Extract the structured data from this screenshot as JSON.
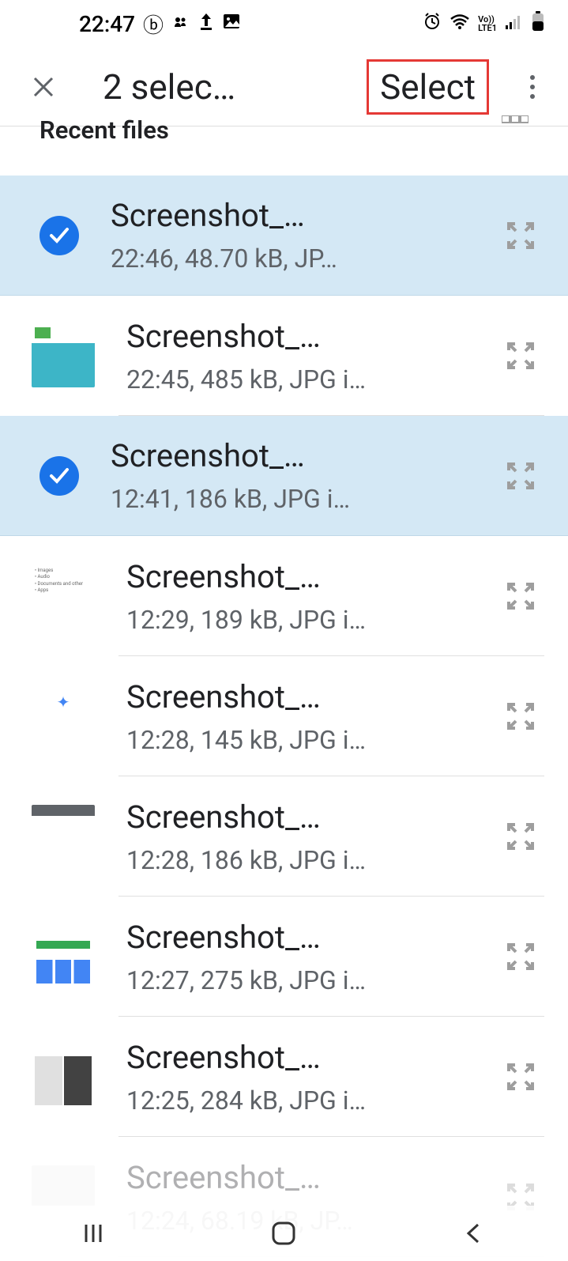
{
  "status": {
    "time": "22:47",
    "network_label": "LTE1",
    "volte": "Vo))"
  },
  "header": {
    "title": "2 selec…",
    "select_label": "Select"
  },
  "section": {
    "title": "Recent files"
  },
  "files": [
    {
      "name": "Screenshot_…",
      "meta": "22:46, 48.70 kB, JP…",
      "selected": true,
      "thumb": "none"
    },
    {
      "name": "Screenshot_…",
      "meta": "22:45, 485 kB, JPG i…",
      "selected": false,
      "thumb": "pool"
    },
    {
      "name": "Screenshot_…",
      "meta": "12:41, 186 kB, JPG i…",
      "selected": true,
      "thumb": "none"
    },
    {
      "name": "Screenshot_…",
      "meta": "12:29, 189 kB, JPG i…",
      "selected": false,
      "thumb": "text"
    },
    {
      "name": "Screenshot_…",
      "meta": "12:28, 145 kB, JPG i…",
      "selected": false,
      "thumb": "app1"
    },
    {
      "name": "Screenshot_…",
      "meta": "12:28, 186 kB, JPG i…",
      "selected": false,
      "thumb": "app2"
    },
    {
      "name": "Screenshot_…",
      "meta": "12:27, 275 kB, JPG i…",
      "selected": false,
      "thumb": "app3"
    },
    {
      "name": "Screenshot_…",
      "meta": "12:25, 284 kB, JPG i…",
      "selected": false,
      "thumb": "gallery"
    },
    {
      "name": "Screenshot_…",
      "meta": "12:24, 68.19 kB, JP…",
      "selected": false,
      "thumb": "none",
      "faded": true
    }
  ]
}
